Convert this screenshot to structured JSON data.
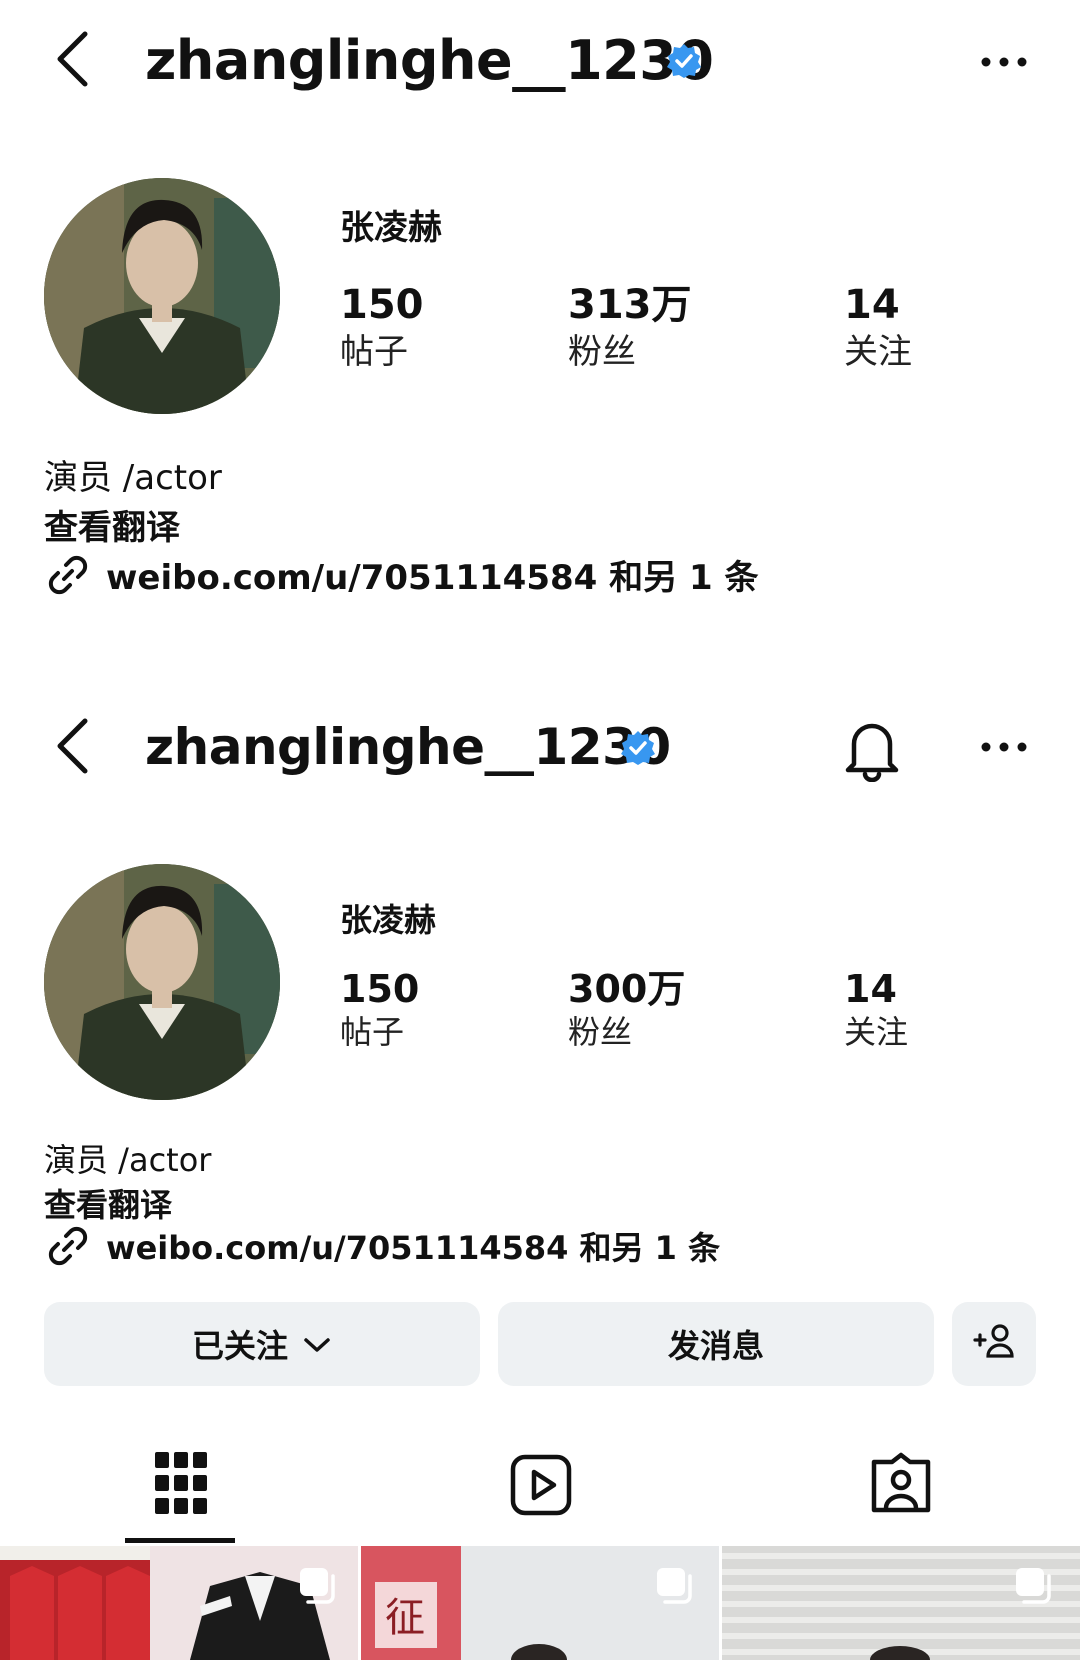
{
  "screens": [
    {
      "username": "zhanglinghe__1230",
      "display_name": "张凌赫",
      "stats": [
        {
          "value": "150",
          "label": "帖子"
        },
        {
          "value": "313万",
          "label": "粉丝"
        },
        {
          "value": "14",
          "label": "关注"
        }
      ],
      "bio": "演员 /actor",
      "translate": "查看翻译",
      "link": "weibo.com/u/7051114584 和另 1 条"
    },
    {
      "username": "zhanglinghe__1230",
      "display_name": "张凌赫",
      "stats": [
        {
          "value": "150",
          "label": "帖子"
        },
        {
          "value": "300万",
          "label": "粉丝"
        },
        {
          "value": "14",
          "label": "关注"
        }
      ],
      "bio": "演员 /actor",
      "translate": "查看翻译",
      "link": "weibo.com/u/7051114584 和另 1 条"
    }
  ],
  "buttons": {
    "following": "已关注",
    "message": "发消息"
  },
  "colors": {
    "verified": "#3897f0",
    "button_bg": "#eef1f3"
  },
  "icons": [
    "back-icon",
    "verified-icon",
    "more-icon",
    "bell-icon",
    "link-icon",
    "chevron-down-icon",
    "add-person-icon",
    "grid-icon",
    "reels-icon",
    "tagged-icon",
    "multi-post-icon"
  ]
}
